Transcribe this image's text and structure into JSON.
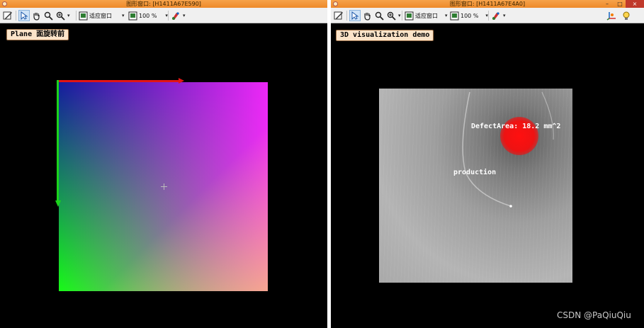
{
  "left_window": {
    "title": "图形窗口: [H1411A67E590]",
    "canvas_label": "Plane 面旋转前",
    "toolbar": {
      "fit_label": "适应窗口",
      "zoom_label": "100 %"
    }
  },
  "right_window": {
    "title": "图形窗口: [H1411A67E4A0]",
    "canvas_label": "3D visualization demo",
    "toolbar": {
      "fit_label": "适应窗口",
      "zoom_label": "100 %"
    },
    "overlay": {
      "defect_area": "DefectArea: 18.2 mm^2",
      "production": "production"
    }
  },
  "window_controls": {
    "minimize": "–",
    "maximize": "□",
    "close": "×"
  },
  "watermark": "CSDN @PaQiuQiu",
  "colors": {
    "titlebar": "#ee8a2a",
    "label_bg": "#fbe4c9",
    "x_axis": "#e21515",
    "y_axis": "#1bd41b",
    "defect": "#ee1212"
  },
  "icons": [
    "draw-icon",
    "pointer-icon",
    "hand-pan-icon",
    "zoom-icon",
    "magnifier-zoom-icon",
    "fit-window-icon",
    "zoom-percent-icon",
    "color-paint-icon",
    "3d-axis-icon",
    "lightbulb-icon"
  ]
}
